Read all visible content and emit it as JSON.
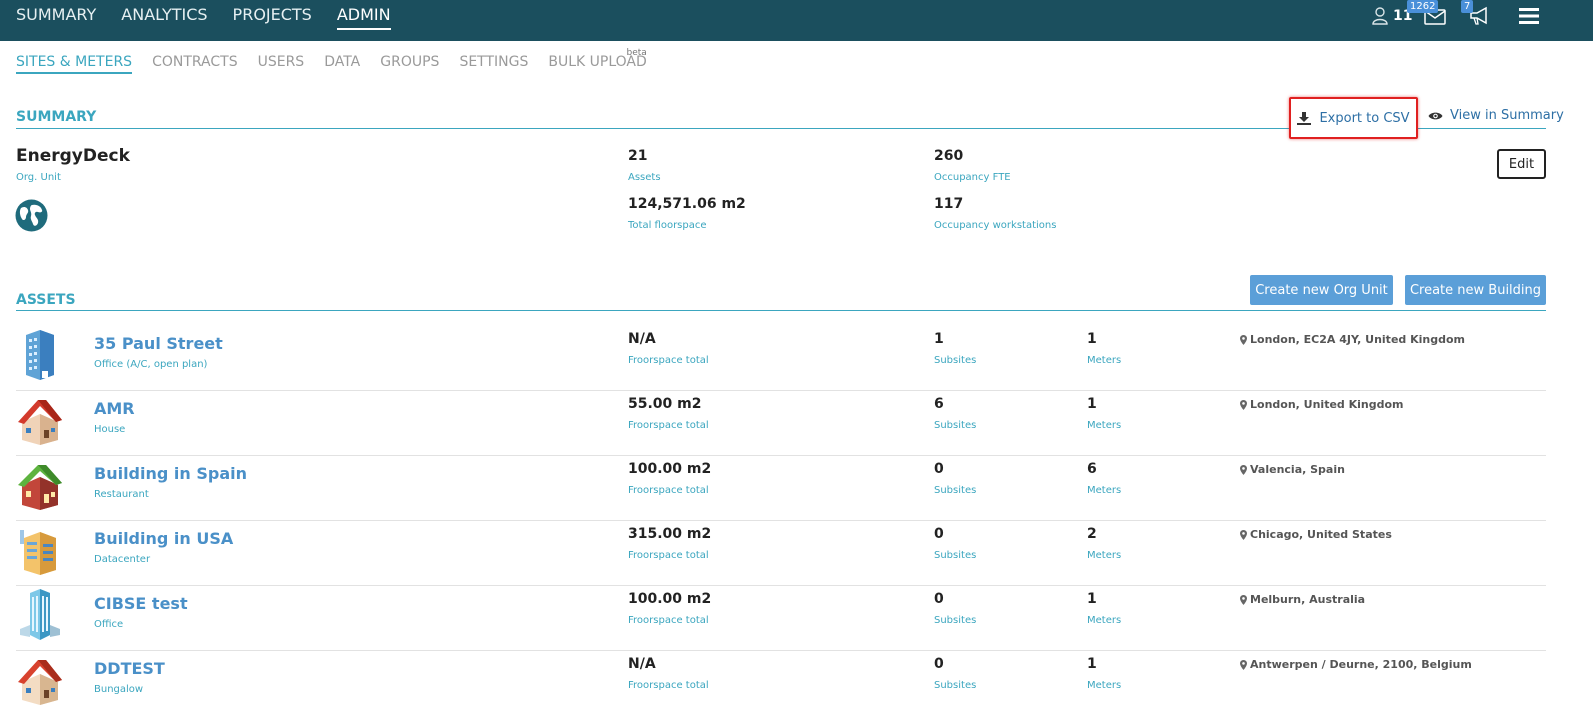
{
  "topnav": {
    "items": [
      {
        "label": "SUMMARY",
        "active": false
      },
      {
        "label": "ANALYTICS",
        "active": false
      },
      {
        "label": "PROJECTS",
        "active": false
      },
      {
        "label": "ADMIN",
        "active": true
      }
    ],
    "users_count": "11",
    "mail_badge": "1262",
    "notif_badge": "7"
  },
  "subnav": {
    "items": [
      {
        "label": "SITES & METERS",
        "active": true
      },
      {
        "label": "CONTRACTS",
        "active": false
      },
      {
        "label": "USERS",
        "active": false
      },
      {
        "label": "DATA",
        "active": false
      },
      {
        "label": "GROUPS",
        "active": false
      },
      {
        "label": "SETTINGS",
        "active": false
      },
      {
        "label": "BULK UPLOAD",
        "active": false,
        "badge": "beta"
      }
    ]
  },
  "summary": {
    "title": "SUMMARY",
    "export_label": "Export to CSV",
    "view_label": "View in Summary",
    "org_name": "EnergyDeck",
    "org_type": "Org. Unit",
    "assets_value": "21",
    "assets_label": "Assets",
    "floor_value": "124,571.06 m2",
    "floor_label": "Total floorspace",
    "fte_value": "260",
    "fte_label": "Occupancy FTE",
    "ws_value": "117",
    "ws_label": "Occupancy workstations",
    "edit_label": "Edit"
  },
  "assets": {
    "title": "ASSETS",
    "create_org_label": "Create new Org Unit",
    "create_building_label": "Create new Building",
    "floor_label": "Froorspace total",
    "subsites_label": "Subsites",
    "meters_label": "Meters",
    "rows": [
      {
        "name": "35 Paul Street",
        "type": "Office (A/C, open plan)",
        "floor": "N/A",
        "subsites": "1",
        "meters": "1",
        "location": "London, EC2A 4JY, United Kingdom",
        "icon": "office-tower-icon"
      },
      {
        "name": "AMR",
        "type": "House",
        "floor": "55.00 m2",
        "subsites": "6",
        "meters": "1",
        "location": "London, United Kingdom",
        "icon": "house-icon"
      },
      {
        "name": "Building in Spain",
        "type": "Restaurant",
        "floor": "100.00 m2",
        "subsites": "0",
        "meters": "6",
        "location": "Valencia, Spain",
        "icon": "restaurant-icon"
      },
      {
        "name": "Building in USA",
        "type": "Datacenter",
        "floor": "315.00 m2",
        "subsites": "0",
        "meters": "2",
        "location": "Chicago, United States",
        "icon": "datacenter-icon"
      },
      {
        "name": "CIBSE test",
        "type": "Office",
        "floor": "100.00 m2",
        "subsites": "0",
        "meters": "1",
        "location": "Melburn, Australia",
        "icon": "office-icon"
      },
      {
        "name": "DDTEST",
        "type": "Bungalow",
        "floor": "N/A",
        "subsites": "0",
        "meters": "1",
        "location": "Antwerpen / Deurne, 2100, Belgium",
        "icon": "bungalow-icon"
      }
    ]
  },
  "colors": {
    "topbar": "#1b4f5e",
    "accent": "#3ba6bf",
    "link": "#2d6fa5",
    "button": "#5b9fd8",
    "highlight": "#e02020"
  }
}
